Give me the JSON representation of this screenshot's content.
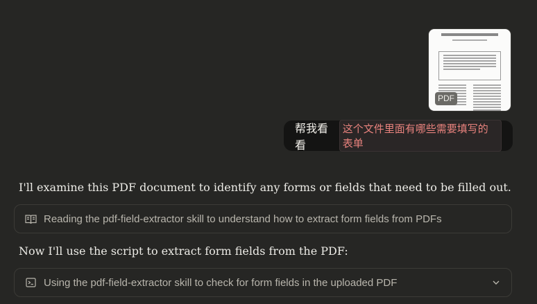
{
  "attachment": {
    "badge": "PDF",
    "icon": "pdf-thumbnail"
  },
  "user_message": {
    "prefix": "帮我看看",
    "highlight": "这个文件里面有哪些需要填写的表单"
  },
  "assistant": {
    "intro": "I'll examine this PDF document to identify any forms or fields that need to be filled out.",
    "tool1": {
      "icon": "book-icon",
      "label": "Reading the pdf-field-extractor skill to understand how to extract form fields from PDFs"
    },
    "followup": "Now I'll use the script to extract form fields from the PDF:",
    "tool2": {
      "icon": "terminal-icon",
      "label": "Using the pdf-field-extractor skill to check for form fields in the uploaded PDF",
      "expand_icon": "chevron-down-icon"
    }
  }
}
